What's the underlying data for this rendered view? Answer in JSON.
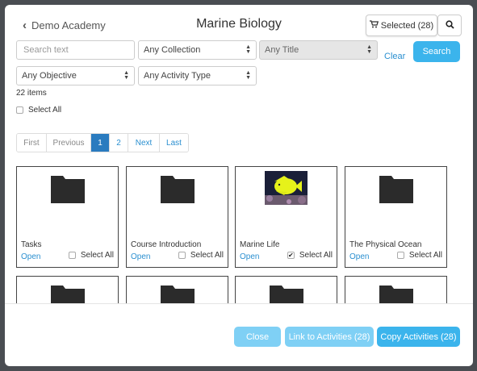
{
  "header": {
    "back_label": "Demo Academy",
    "title": "Marine Biology",
    "selected_label": "Selected (28)"
  },
  "filters": {
    "search_placeholder": "Search text",
    "collection": "Any Collection",
    "title": "Any Title",
    "objective": "Any Objective",
    "activity_type": "Any Activity Type",
    "clear_label": "Clear",
    "search_label": "Search"
  },
  "results": {
    "count": "22 items",
    "select_all": "Select All"
  },
  "pager": {
    "first": "First",
    "previous": "Previous",
    "page1": "1",
    "page2": "2",
    "next": "Next",
    "last": "Last"
  },
  "cards": [
    {
      "name": "Tasks",
      "open": "Open",
      "select": "Select All",
      "checked": false,
      "icon": "folder-icon"
    },
    {
      "name": "Course Introduction",
      "open": "Open",
      "select": "Select All",
      "checked": false,
      "icon": "folder-icon"
    },
    {
      "name": "Marine Life",
      "open": "Open",
      "select": "Select All",
      "checked": true,
      "icon": "fish-image"
    },
    {
      "name": "The Physical Ocean",
      "open": "Open",
      "select": "Select All",
      "checked": false,
      "icon": "folder-icon"
    }
  ],
  "footer": {
    "close": "Close",
    "link": "Link to Activities (28)",
    "copy": "Copy Activities (28)"
  },
  "colors": {
    "primary": "#3bb4ec",
    "primary_light": "#7fd0f5",
    "link": "#2a8fd0",
    "active_page": "#2a7bbf"
  }
}
